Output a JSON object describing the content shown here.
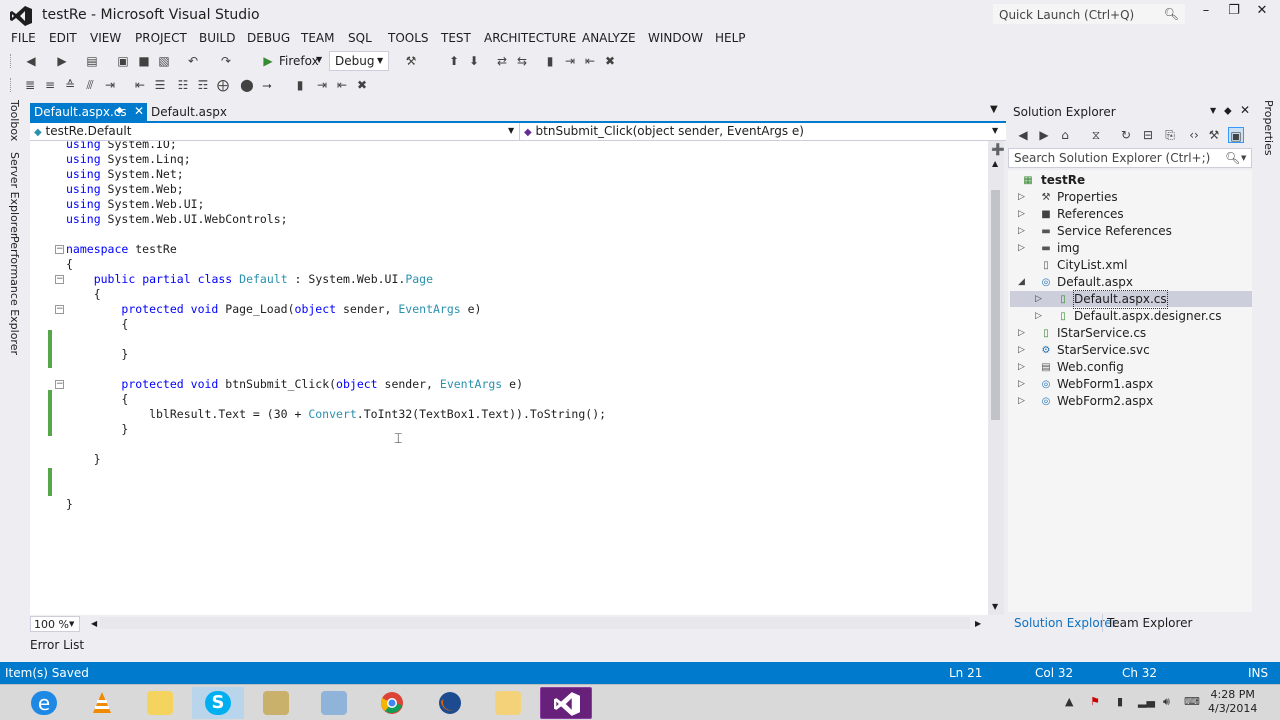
{
  "window": {
    "title": "testRe - Microsoft Visual Studio",
    "quick_launch_placeholder": "Quick Launch (Ctrl+Q)",
    "controls": {
      "minimize": "–",
      "restore": "❐",
      "close": "✕"
    }
  },
  "menu": [
    "FILE",
    "EDIT",
    "VIEW",
    "PROJECT",
    "BUILD",
    "DEBUG",
    "TEAM",
    "SQL",
    "TOOLS",
    "TEST",
    "ARCHITECTURE",
    "ANALYZE",
    "WINDOW",
    "HELP"
  ],
  "toolbar": {
    "run_target": "Firefox",
    "configuration": "Debug"
  },
  "left_strip": [
    "Toolbox",
    "Server Explorer",
    "Performance Explorer"
  ],
  "right_strip": [
    "Properties"
  ],
  "tabs": [
    {
      "label": "Default.aspx.cs",
      "active": true
    },
    {
      "label": "Default.aspx",
      "active": false
    }
  ],
  "navigation": {
    "class": "testRe.Default",
    "member": "btnSubmit_Click(object sender, EventArgs e)"
  },
  "code_lines": [
    "using System.IO;",
    "using System.Linq;",
    "using System.Net;",
    "using System.Web;",
    "using System.Web.UI;",
    "using System.Web.UI.WebControls;",
    "",
    "namespace testRe",
    "{",
    "    public partial class Default : System.Web.UI.Page",
    "    {",
    "        protected void Page_Load(object sender, EventArgs e)",
    "        {",
    "",
    "        }",
    "",
    "        protected void btnSubmit_Click(object sender, EventArgs e)",
    "        {",
    "            lblResult.Text = (30 + Convert.ToInt32(TextBox1.Text)).ToString();",
    "        }",
    "",
    "    }",
    "",
    "",
    "}"
  ],
  "editor": {
    "zoom": "100 %"
  },
  "bottom_panel_tab": "Error List",
  "solution_explorer": {
    "title": "Solution Explorer",
    "search_placeholder": "Search Solution Explorer (Ctrl+;)",
    "project": "testRe",
    "items": [
      {
        "label": "Properties",
        "icon": "wrench-icon",
        "depth": 1,
        "arrow": "collapsed"
      },
      {
        "label": "References",
        "icon": "references-icon",
        "depth": 1,
        "arrow": "collapsed"
      },
      {
        "label": "Service References",
        "icon": "folder-icon",
        "depth": 1,
        "arrow": "collapsed"
      },
      {
        "label": "img",
        "icon": "folder-icon",
        "depth": 1,
        "arrow": "collapsed"
      },
      {
        "label": "CityList.xml",
        "icon": "xml-file-icon",
        "depth": 1,
        "arrow": "none"
      },
      {
        "label": "Default.aspx",
        "icon": "web-page-icon",
        "depth": 1,
        "arrow": "expanded"
      },
      {
        "label": "Default.aspx.cs",
        "icon": "cs-file-icon",
        "depth": 2,
        "arrow": "collapsed",
        "selected": true
      },
      {
        "label": "Default.aspx.designer.cs",
        "icon": "cs-file-icon",
        "depth": 2,
        "arrow": "collapsed"
      },
      {
        "label": "IStarService.cs",
        "icon": "cs-file-icon",
        "depth": 1,
        "arrow": "collapsed"
      },
      {
        "label": "StarService.svc",
        "icon": "service-icon",
        "depth": 1,
        "arrow": "collapsed"
      },
      {
        "label": "Web.config",
        "icon": "config-icon",
        "depth": 1,
        "arrow": "collapsed"
      },
      {
        "label": "WebForm1.aspx",
        "icon": "web-page-icon",
        "depth": 1,
        "arrow": "collapsed"
      },
      {
        "label": "WebForm2.aspx",
        "icon": "web-page-icon",
        "depth": 1,
        "arrow": "collapsed"
      }
    ],
    "bottom_tabs": [
      "Solution Explorer",
      "Team Explorer"
    ]
  },
  "status_bar": {
    "message": "Item(s) Saved",
    "line": "Ln 21",
    "col": "Col 32",
    "ch": "Ch 32",
    "mode": "INS"
  },
  "taskbar": {
    "apps": [
      "ie",
      "vlc",
      "explorer-notes",
      "skype",
      "tools",
      "files",
      "chrome",
      "firefox",
      "folder",
      "visual-studio"
    ],
    "time": "4:28 PM",
    "date": "4/3/2014"
  }
}
